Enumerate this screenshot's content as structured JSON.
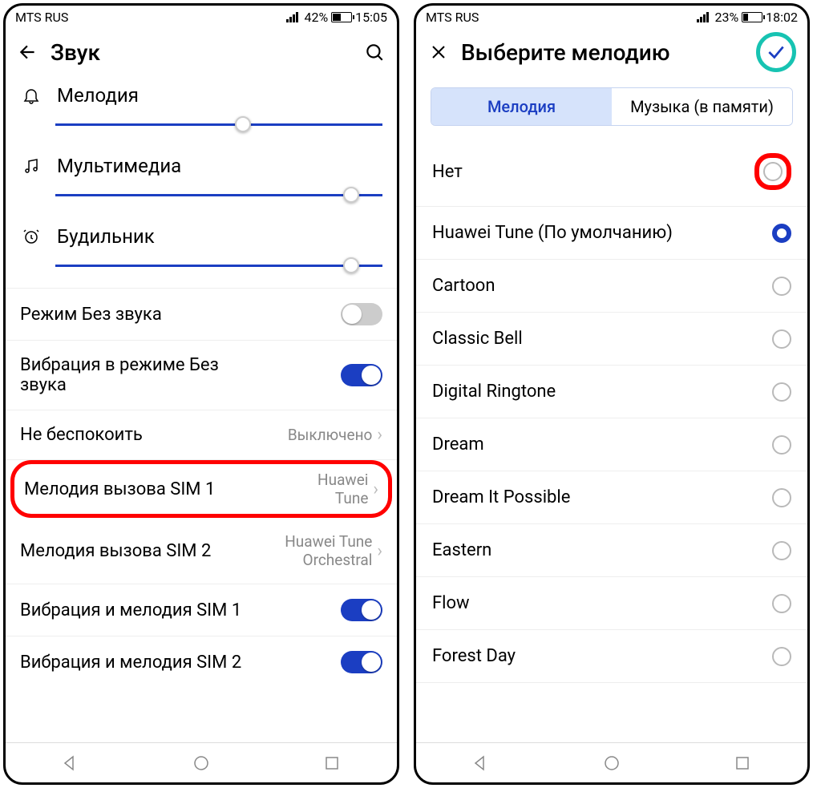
{
  "left": {
    "status": {
      "carrier": "MTS RUS",
      "battery_pct": "42%",
      "battery_fill": 42,
      "time": "15:05"
    },
    "header": {
      "title": "Звук"
    },
    "volumes": [
      {
        "icon": "bell",
        "label": "Мелодия",
        "pos": 55
      },
      {
        "icon": "music",
        "label": "Мультимедиа",
        "pos": 88
      },
      {
        "icon": "alarm",
        "label": "Будильник",
        "pos": 88
      }
    ],
    "rows": {
      "silent": {
        "label": "Режим Без звука"
      },
      "vibrate_silent": {
        "label": "Вибрация в режиме Без звука"
      },
      "dnd": {
        "label": "Не беспокоить",
        "value": "Выключено"
      },
      "sim1": {
        "label": "Мелодия вызова SIM 1",
        "value": "Huawei Tune"
      },
      "sim2": {
        "label": "Мелодия вызова SIM 2",
        "value": "Huawei Tune Orchestral"
      },
      "vib_sim1": {
        "label": "Вибрация и мелодия SIM 1"
      },
      "vib_sim2": {
        "label": "Вибрация и мелодия SIM 2"
      }
    }
  },
  "right": {
    "status": {
      "carrier": "MTS RUS",
      "battery_pct": "23%",
      "battery_fill": 23,
      "time": "18:02"
    },
    "header": {
      "title": "Выберите мелодию"
    },
    "tabs": {
      "melody": "Мелодия",
      "music": "Музыка (в памяти)"
    },
    "ringtones": [
      {
        "name": "Нет",
        "selected": false,
        "highlight": true
      },
      {
        "name": "Huawei Tune (По умолчанию)",
        "selected": true
      },
      {
        "name": "Cartoon",
        "selected": false
      },
      {
        "name": "Classic Bell",
        "selected": false
      },
      {
        "name": "Digital Ringtone",
        "selected": false
      },
      {
        "name": "Dream",
        "selected": false
      },
      {
        "name": "Dream It Possible",
        "selected": false
      },
      {
        "name": "Eastern",
        "selected": false
      },
      {
        "name": "Flow",
        "selected": false
      },
      {
        "name": "Forest Day",
        "selected": false
      }
    ]
  }
}
